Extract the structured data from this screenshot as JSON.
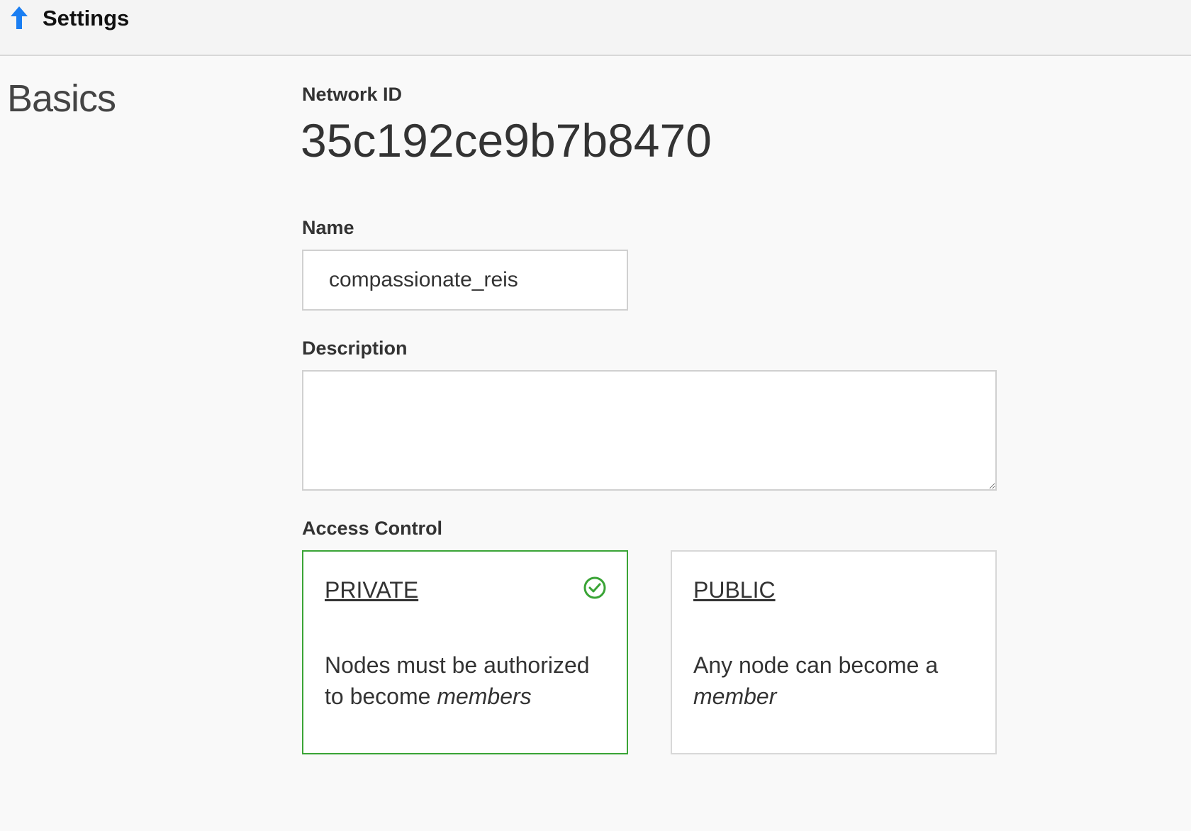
{
  "header": {
    "title": "Settings",
    "back_icon": "arrow-up-icon",
    "accent_color": "#1a7ef2"
  },
  "section": {
    "title": "Basics"
  },
  "network": {
    "id_label": "Network ID",
    "id_value": "35c192ce9b7b8470"
  },
  "name": {
    "label": "Name",
    "value": "compassionate_reis"
  },
  "description": {
    "label": "Description",
    "value": ""
  },
  "access_control": {
    "label": "Access Control",
    "options": [
      {
        "title": "PRIVATE",
        "text": "Nodes must be authorized to become ",
        "emphasis": "members",
        "selected": true,
        "selected_icon": "check-circle-icon",
        "selected_color": "#3aa436"
      },
      {
        "title": "PUBLIC",
        "text": "Any node can become a ",
        "emphasis": "member",
        "selected": false
      }
    ]
  }
}
